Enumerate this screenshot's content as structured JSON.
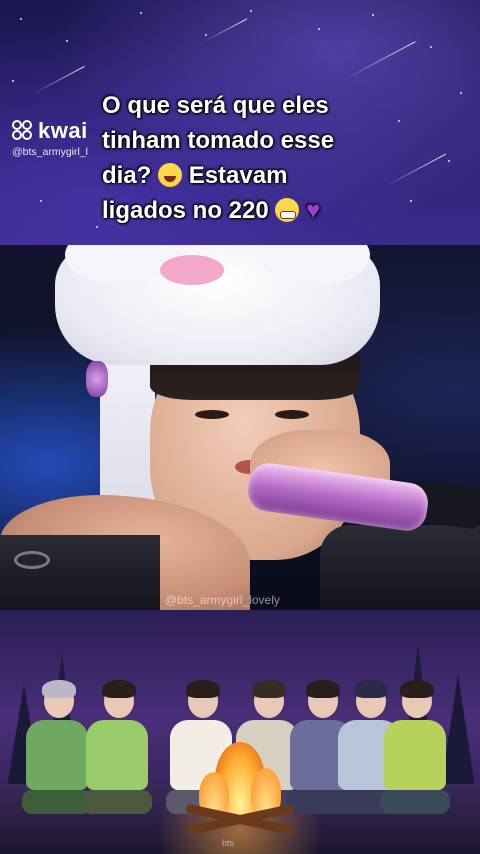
{
  "header": {
    "logo_text": "kwai",
    "handle": "@bts_armygirl_l",
    "caption_lines": [
      "O que será que eles",
      "tinham tomado esse",
      "dia?",
      "Estavam",
      "ligados no 220"
    ],
    "emojis": [
      "laughing-crying-face",
      "grinning-face",
      "purple-heart"
    ]
  },
  "photo": {
    "watermark": "@bts_armygirl_lovely",
    "description_icon": "microphone"
  },
  "illustration": {
    "watermark": "bts"
  },
  "colors": {
    "caption_text": "#ffffff",
    "heart": "#9b3fd6",
    "banner_bg": "#2a2170"
  }
}
